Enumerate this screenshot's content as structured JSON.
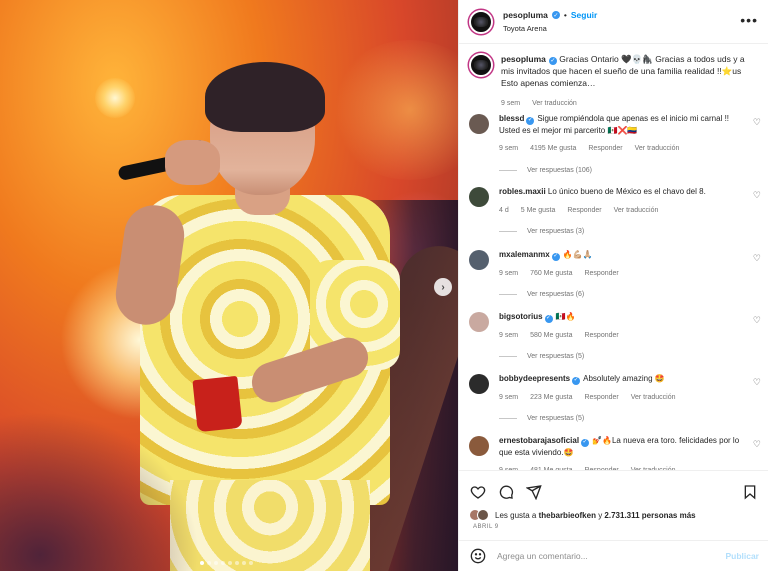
{
  "post": {
    "username": "pesopluma",
    "follow_label": "Seguir",
    "location": "Toyota Arena",
    "more_label": "•••",
    "caption_text": "Gracias Ontario 🖤💀🦍 Gracias a todos uds y a mis invitados que hacen el sueño de una familia realidad !!⭐us Esto apenas comienza…",
    "caption_time": "9 sem",
    "caption_translate": "Ver traducción"
  },
  "comments": [
    {
      "username": "blessd",
      "verified": true,
      "text": "Sigue rompiéndola que apenas es el inicio mi carnal !! Usted es el mejor mi parcerito 🇲🇽❌🇨🇴",
      "time": "9 sem",
      "likes": "4195 Me gusta",
      "reply": "Responder",
      "translate": "Ver traducción",
      "replies": "Ver respuestas (106)",
      "avatar_color": "#6a5a52"
    },
    {
      "username": "robles.maxii",
      "verified": false,
      "text": "Lo único bueno de México es el chavo del 8.",
      "time": "4 d",
      "likes": "5 Me gusta",
      "reply": "Responder",
      "translate": "Ver traducción",
      "replies": "Ver respuestas (3)",
      "avatar_color": "#3e4a3a"
    },
    {
      "username": "mxalemanmx",
      "verified": true,
      "text": "🔥💪🏼🙏🏼",
      "time": "9 sem",
      "likes": "760 Me gusta",
      "reply": "Responder",
      "translate": "",
      "replies": "Ver respuestas (6)",
      "avatar_color": "#55606e"
    },
    {
      "username": "bigsotorius",
      "verified": true,
      "text": "🇲🇽🔥",
      "time": "9 sem",
      "likes": "580 Me gusta",
      "reply": "Responder",
      "translate": "",
      "replies": "Ver respuestas (5)",
      "avatar_color": "#c9a9a0"
    },
    {
      "username": "bobbydeepresents",
      "verified": true,
      "text": "Absolutely amazing 🤩",
      "time": "9 sem",
      "likes": "223 Me gusta",
      "reply": "Responder",
      "translate": "Ver traducción",
      "replies": "Ver respuestas (5)",
      "avatar_color": "#2b2b2b"
    },
    {
      "username": "ernestobarajasoficial",
      "verified": true,
      "text": "💅🔥La nueva era toro. felicidades por lo que esta viviendo.🤩",
      "time": "9 sem",
      "likes": "481 Me gusta",
      "reply": "Responder",
      "translate": "Ver traducción",
      "replies": "",
      "avatar_color": "#8a5a3c"
    }
  ],
  "likes_text": "Les gusta a",
  "likes_user": "thebarbieofken",
  "likes_and": "y",
  "likes_count": "2.731.311 personas más",
  "date": "ABRIL 9",
  "add_comment_placeholder": "Agrega un comentario...",
  "publish_label": "Publicar",
  "colors": {
    "accent": "#0095f6",
    "verified": "#3897f0",
    "ring": "#c13584"
  }
}
